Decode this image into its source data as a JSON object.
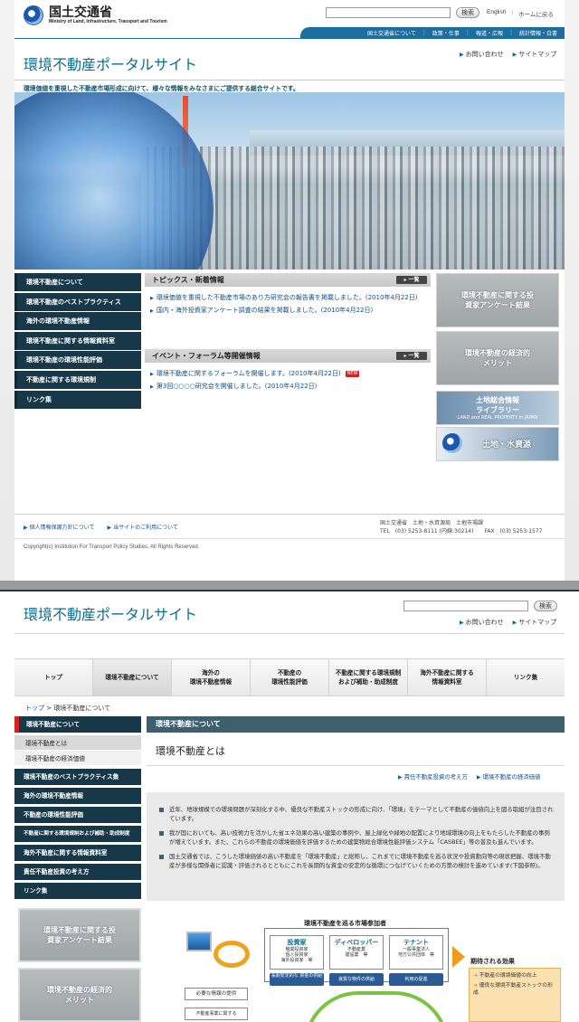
{
  "p1": {
    "logo": {
      "jp": "国土交通省",
      "en": "Ministry of Land, Infrastructure, Transport and Tourism"
    },
    "search": {
      "placeholder": "",
      "button": "検索"
    },
    "top_links": [
      "English",
      "ホームに戻る"
    ],
    "gnav": [
      "国土交通省について",
      "政策・仕事",
      "報道・広報",
      "統計情報・白書"
    ],
    "site_title": "環境不動産ポータルサイト",
    "right_links": [
      "お問い合わせ",
      "サイトマップ"
    ],
    "tagline": "環境価値を重視した不動産市場形成に向けて、様々な情報をみなさまにご提供する総合サイトです。",
    "left_nav": [
      "環境不動産について",
      "環境不動産のベストプラクティス",
      "海外の環境不動産情報",
      "環境不動産に関する情報資料室",
      "環境不動産の環境性能評価",
      "不動産に関する環境規制",
      "リンク集"
    ],
    "topics": {
      "title": "トピックス・新着情報",
      "more": "一覧",
      "items": [
        "環境価値を重視した不動産市場のあり方研究会の報告書を掲載しました。(2010年4月22日)",
        "国内・海外投資家アンケート調査の結果を掲載しました。(2010年4月22日)"
      ]
    },
    "events": {
      "title": "イベント・フォーラム等開催情報",
      "more": "一覧",
      "items": [
        "環境不動産に関するフォーラムを開催します。(2010年4月22日)",
        "第3回○○○○研究会を開催しました。(2010年4月22日)"
      ],
      "new_badge": "NEW"
    },
    "banners": {
      "survey": "環境不動産に関する投資家アンケート結果",
      "merit": "環境不動産の経済的メリット",
      "land_lib_1": "土地総合情報",
      "land_lib_2": "ライブラリー",
      "land_lib_3": "LAND and REAL PROPERTY in JAPAN",
      "water": "土地・水資源"
    },
    "footer": {
      "links": [
        "個人情報保護方針について",
        "当サイトのご利用について"
      ],
      "addr1": "国土交通省　土地・水資源局　土地市場課",
      "addr2": "TEL　(03) 5253-8111 (内線:30214)　　FAX　(03) 5253-1577",
      "copyright": "Copyright(c) Institution For Transport Policy Studies, All Rights Reserved."
    }
  },
  "p2": {
    "site_title": "環境不動産ポータルサイト",
    "search_button": "検索",
    "right_links": [
      "お問い合わせ",
      "サイトマップ"
    ],
    "tabs": [
      "トップ",
      "環境不動産について",
      "海外の\n環境不動産情報",
      "不動産の\n環境性能評価",
      "不動産に関する環境規制\nおよび補助・助成制度",
      "海外不動産に関する\n情報資料室",
      "リンク集"
    ],
    "breadcrumb": {
      "home": "トップ",
      "current": "環境不動産について"
    },
    "left_nav": {
      "head": "環境不動産について",
      "sub": [
        "環境不動産とは",
        "環境不動産の経済価値"
      ],
      "items": [
        "環境不動産のベストプラクティス集",
        "海外の環境不動産情報",
        "不動産の環境性能評価",
        "不動産に関する環境規制および補助・助成制度",
        "海外不動産に関する情報資料室",
        "責任不動産投資の考え方",
        "リンク集"
      ]
    },
    "banners": {
      "survey": "環境不動産に関する投資家アンケート結果",
      "merit": "環境不動産の経済的メリット"
    },
    "section_title": "環境不動産について",
    "heading": "環境不動産とは",
    "related": [
      "責任不動産投資の考え方",
      "環境不動産の経済価値"
    ],
    "paragraphs": [
      "近年、地球規模での環境問題が深刻化する中、優良な不動産ストックの形成に向け、「環境」をテーマとして不動産の価値向上を図る取組が注目されています。",
      "我が国においても、高い技術力を活かした省エネ効果の高い建築の事例や、屋上緑化や緑地の配置により地域環境の向上をもたらした不動産の事例が増えています。また、これらの不動産の環境価値を評価するための建築物総合環境性能評価システム「CASBEE」等の普及も進んでいます。",
      "国土交通省では、こうした環境価値の高い不動産を「環境不動産」と総称し、これまでに環境不動産を巡る状況や投資動向等の現状把握、環境不動産が多様な関係者に認識・評価されるとともにこれを長期的な資金の安定的な循環につなげていくための方策の検討を進めています(下図参照)。"
    ],
    "diagram": {
      "title": "環境不動産を巡る市場参加者",
      "cards": [
        {
          "h": "投資家",
          "s": "機関投資家\n個人投資家\n海外投資家　等",
          "tag": "長期安定的な\n資金の供給"
        },
        {
          "h": "ディベロッパー",
          "s": "不動産業\n建設業　等",
          "tag": "良質な物件の供給"
        },
        {
          "h": "テナント",
          "s": "一般事業法人\n地方公共団体　等",
          "tag": "利用の促進"
        }
      ],
      "need": "必要な情報の提供",
      "need2": "不動産事業に関する",
      "effect_title": "期待される効果",
      "effects": [
        "不動産の環境価値の向上",
        "優良な環境不動産ストックの形成"
      ]
    }
  }
}
